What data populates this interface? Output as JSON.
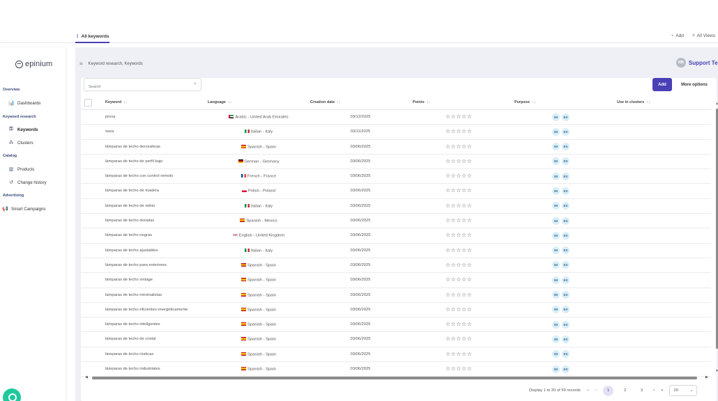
{
  "top_tabs": {
    "active": "All keywords",
    "add_label": "Add",
    "all_views_label": "All Views"
  },
  "logo": {
    "text": "epinium"
  },
  "sidebar": {
    "sections": {
      "overview": "Overview",
      "keyword_research": "Keyword research",
      "catalog": "Catalog",
      "advertising": "Advertising"
    },
    "items": {
      "dashboards": "Dashboards",
      "keywords": "Keywords",
      "clusters": "Clusters",
      "products": "Products",
      "change_history": "Change history",
      "smart_campaigns": "Smart Campaigns"
    }
  },
  "breadcrumb": {
    "parent": "Keyword research,",
    "current": "Keywords"
  },
  "user": {
    "initials": "RB",
    "name": "Support Tes"
  },
  "toolbar": {
    "search_placeholder": "Search",
    "add_label": "Add",
    "more_label": "More options"
  },
  "table": {
    "headers": {
      "keyword": "Keyword",
      "language": "Language",
      "creation_date": "Creation date",
      "points": "Points",
      "purpose": "Purpose",
      "clusters": "Use in clusters"
    },
    "sort_icon": "↑↓",
    "stars": "☆☆☆☆☆",
    "purpose_badges": [
      "IM",
      "ES"
    ],
    "rows": [
      {
        "keyword": "prova",
        "language": "Arabic - United Arab Emirates",
        "flag": "ae",
        "date": "03/12/2025"
      },
      {
        "keyword": "xava",
        "language": "Italian - Italy",
        "flag": "it",
        "date": "03/11/2025"
      },
      {
        "keyword": "lámparas de techo decorativas",
        "language": "Spanish - Spain",
        "flag": "es",
        "date": "03/06/2025"
      },
      {
        "keyword": "lámparas de techo de perfil bajo",
        "language": "German - Germany",
        "flag": "de",
        "date": "03/06/2025"
      },
      {
        "keyword": "lámparas de techo con control remoto",
        "language": "French - France",
        "flag": "fr",
        "date": "03/06/2025"
      },
      {
        "keyword": "lámparas de techo de madera",
        "language": "Polish - Poland",
        "flag": "pl",
        "date": "03/06/2025"
      },
      {
        "keyword": "lámparas de techo de vidrio",
        "language": "Italian - Italy",
        "flag": "it",
        "date": "03/06/2025"
      },
      {
        "keyword": "lámparas de techo doradas",
        "language": "Spanish - Mexico",
        "flag": "es",
        "date": "03/06/2025"
      },
      {
        "keyword": "lámparas de techo negras",
        "language": "English - United Kingdom",
        "flag": "gb",
        "date": "03/06/2025"
      },
      {
        "keyword": "lámparas de techo ajustables",
        "language": "Italian - Italy",
        "flag": "it",
        "date": "03/06/2025"
      },
      {
        "keyword": "lámparas de techo para exteriores",
        "language": "Spanish - Spain",
        "flag": "es",
        "date": "03/06/2025"
      },
      {
        "keyword": "lámparas de techo vintage",
        "language": "Spanish - Spain",
        "flag": "es",
        "date": "03/06/2025"
      },
      {
        "keyword": "lámparas de techo minimalistas",
        "language": "Spanish - Spain",
        "flag": "es",
        "date": "03/06/2025"
      },
      {
        "keyword": "lámparas de techo eficientes energéticamente",
        "language": "Spanish - Spain",
        "flag": "es",
        "date": "03/06/2025"
      },
      {
        "keyword": "lámparas de techo inteligentes",
        "language": "Spanish - Spain",
        "flag": "es",
        "date": "03/06/2025"
      },
      {
        "keyword": "lámparas de techo de cristal",
        "language": "Spanish - Spain",
        "flag": "es",
        "date": "03/06/2025"
      },
      {
        "keyword": "lámparas de techo rústicas",
        "language": "Spanish - Spain",
        "flag": "es",
        "date": "03/06/2025"
      },
      {
        "keyword": "lámparas de techo industriales",
        "language": "Spanish - Spain",
        "flag": "es",
        "date": "03/06/2025"
      }
    ]
  },
  "pagination": {
    "summary": "Display 1 to 20 of 59 records",
    "pages": [
      "1",
      "2",
      "3"
    ],
    "current": "1",
    "page_size": "20"
  },
  "colors": {
    "accent": "#4a3fb5",
    "chat": "#1ec99b"
  }
}
